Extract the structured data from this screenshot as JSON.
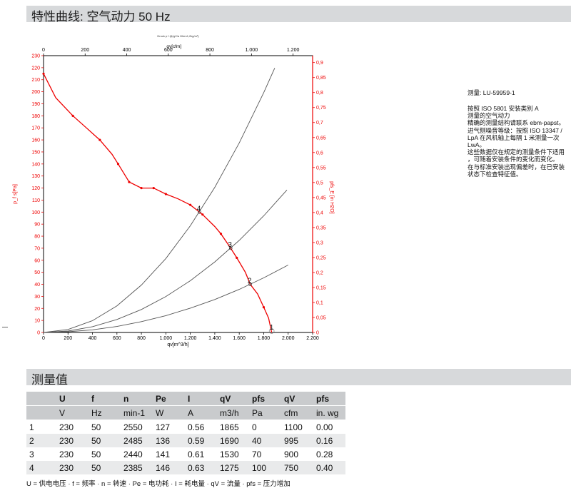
{
  "header": {
    "title": "特性曲线: 空气动力 50 Hz"
  },
  "section2": {
    "title": "测量值"
  },
  "info": {
    "measurement_id": "测量: LU-59959-1",
    "notes": [
      "按照 ISO 5801 安装类别 A",
      "测量的空气动力",
      "精确的测量结构请联系 ebm-papst。",
      "进气侧噪音等级：按照 ISO 13347 /",
      "LpA 在风机轴上每隔 1 米测量一次",
      "LwA。",
      "这些数据仅在规定的测量条件下适用",
      "，可随着安装条件的变化而变化。",
      "在与标准安装出现偏差时，在已安装",
      "状态下检查特征值。"
    ]
  },
  "table": {
    "headers": [
      "",
      "U",
      "f",
      "n",
      "Pe",
      "I",
      "qV",
      "pfs",
      "qV",
      "pfs"
    ],
    "units": [
      "",
      "V",
      "Hz",
      "min-1",
      "W",
      "A",
      "m3/h",
      "Pa",
      "cfm",
      "in. wg"
    ],
    "rows": [
      [
        "1",
        "230",
        "50",
        "2550",
        "127",
        "0.56",
        "1865",
        "0",
        "1100",
        "0.00"
      ],
      [
        "2",
        "230",
        "50",
        "2485",
        "136",
        "0.59",
        "1690",
        "40",
        "995",
        "0.16"
      ],
      [
        "3",
        "230",
        "50",
        "2440",
        "141",
        "0.61",
        "1530",
        "70",
        "900",
        "0.28"
      ],
      [
        "4",
        "230",
        "50",
        "2385",
        "146",
        "0.63",
        "1275",
        "100",
        "750",
        "0.40"
      ]
    ]
  },
  "footnote": "U = 供电电压 · f = 频率 · n = 转速 · Pe = 电功耗 · I = 耗电量 · qV = 流量 · pfs = 压力增加",
  "chart_data": {
    "type": "line",
    "tiny_caption": "Druck p f @(qV/a Wern1,2kg/m³)",
    "xlabel": "qv[m^3/h]",
    "x2label": "qv[cfm]",
    "ylabel": "p_f s[Pa]",
    "y2label": "pfs_E [in H2O]",
    "xlim": [
      0,
      2200
    ],
    "ylim": [
      0,
      230
    ],
    "x2lim": [
      0,
      1294
    ],
    "y2lim": [
      0,
      0.923
    ],
    "x_ticks": [
      0,
      200,
      400,
      600,
      800,
      1000,
      1200,
      1400,
      1600,
      1800,
      2000,
      2200
    ],
    "x_tick_labels": [
      "0",
      "200",
      "400",
      "600",
      "800",
      "1.000",
      "1.200",
      "1.400",
      "1.600",
      "1.800",
      "2.000",
      "2.200"
    ],
    "y_ticks": [
      0,
      10,
      20,
      30,
      40,
      50,
      60,
      70,
      80,
      90,
      100,
      110,
      120,
      130,
      140,
      150,
      160,
      170,
      180,
      190,
      200,
      210,
      220,
      230
    ],
    "x2_ticks": [
      0,
      200,
      400,
      600,
      800,
      1000,
      1200
    ],
    "x2_tick_labels": [
      "0",
      "200",
      "400",
      "600",
      "800",
      "1.000",
      "1.200"
    ],
    "y2_ticks": [
      0,
      0.05,
      0.1,
      0.15,
      0.2,
      0.25,
      0.3,
      0.35,
      0.4,
      0.45,
      0.5,
      0.55,
      0.6,
      0.65,
      0.7,
      0.75,
      0.8,
      0.85,
      0.9
    ],
    "y2_tick_labels": [
      "0",
      "0,05",
      "0,1",
      "0,15",
      "0,2",
      "0,25",
      "0,3",
      "0,35",
      "0,4",
      "0,45",
      "0,5",
      "0,55",
      "0,6",
      "0,65",
      "0,7",
      "0,75",
      "0,8",
      "0,85",
      "0,9"
    ],
    "colors": {
      "fan_curve": "#ee0000",
      "system_curves": "#555555",
      "axis_right": "#ee0000",
      "axis_left": "#ee0000",
      "frame": "#000000"
    },
    "series": [
      {
        "role": "fan_curve",
        "x": [
          0,
          100,
          240,
          350,
          460,
          560,
          610,
          700,
          800,
          900,
          1000,
          1100,
          1200,
          1275,
          1300,
          1400,
          1450,
          1530,
          1580,
          1650,
          1690,
          1750,
          1800,
          1840,
          1865
        ],
        "y": [
          215,
          195,
          180,
          170,
          160,
          148,
          140,
          125,
          120,
          120,
          115,
          111,
          106,
          100,
          98,
          88,
          82,
          70,
          62,
          50,
          40,
          32,
          21,
          12,
          0
        ],
        "markers_x": [
          0,
          240,
          460,
          610,
          700,
          800,
          900,
          1000,
          1200,
          1300,
          1450,
          1580,
          1800
        ],
        "markers_y": [
          215,
          180,
          160,
          140,
          125,
          120,
          120,
          115,
          106,
          98,
          82,
          62,
          21
        ]
      },
      {
        "role": "system_curve",
        "label": "4",
        "label_x": 1275,
        "label_y": 100,
        "x": [
          0,
          200,
          400,
          600,
          800,
          1000,
          1200,
          1400,
          1600,
          1800,
          1890
        ],
        "y": [
          0,
          2.5,
          9.8,
          22.1,
          39.4,
          61.5,
          88.6,
          120.6,
          157.5,
          199.3,
          219.7
        ]
      },
      {
        "role": "system_curve",
        "label": "3",
        "label_x": 1530,
        "label_y": 70,
        "x": [
          0,
          200,
          400,
          600,
          800,
          1000,
          1200,
          1400,
          1600,
          1800,
          1990
        ],
        "y": [
          0,
          1.2,
          4.8,
          10.8,
          19.1,
          29.9,
          43.0,
          58.6,
          76.5,
          96.9,
          118.4
        ]
      },
      {
        "role": "system_curve",
        "label": "2",
        "label_x": 1690,
        "label_y": 40,
        "x": [
          0,
          200,
          400,
          600,
          800,
          1000,
          1200,
          1400,
          1600,
          1800,
          2000
        ],
        "y": [
          0,
          0.6,
          2.2,
          5.0,
          9.0,
          14.0,
          20.2,
          27.4,
          35.8,
          45.4,
          56.0
        ]
      },
      {
        "role": "operating_point",
        "label": "1",
        "label_x": 1865,
        "label_y": 0
      }
    ]
  }
}
